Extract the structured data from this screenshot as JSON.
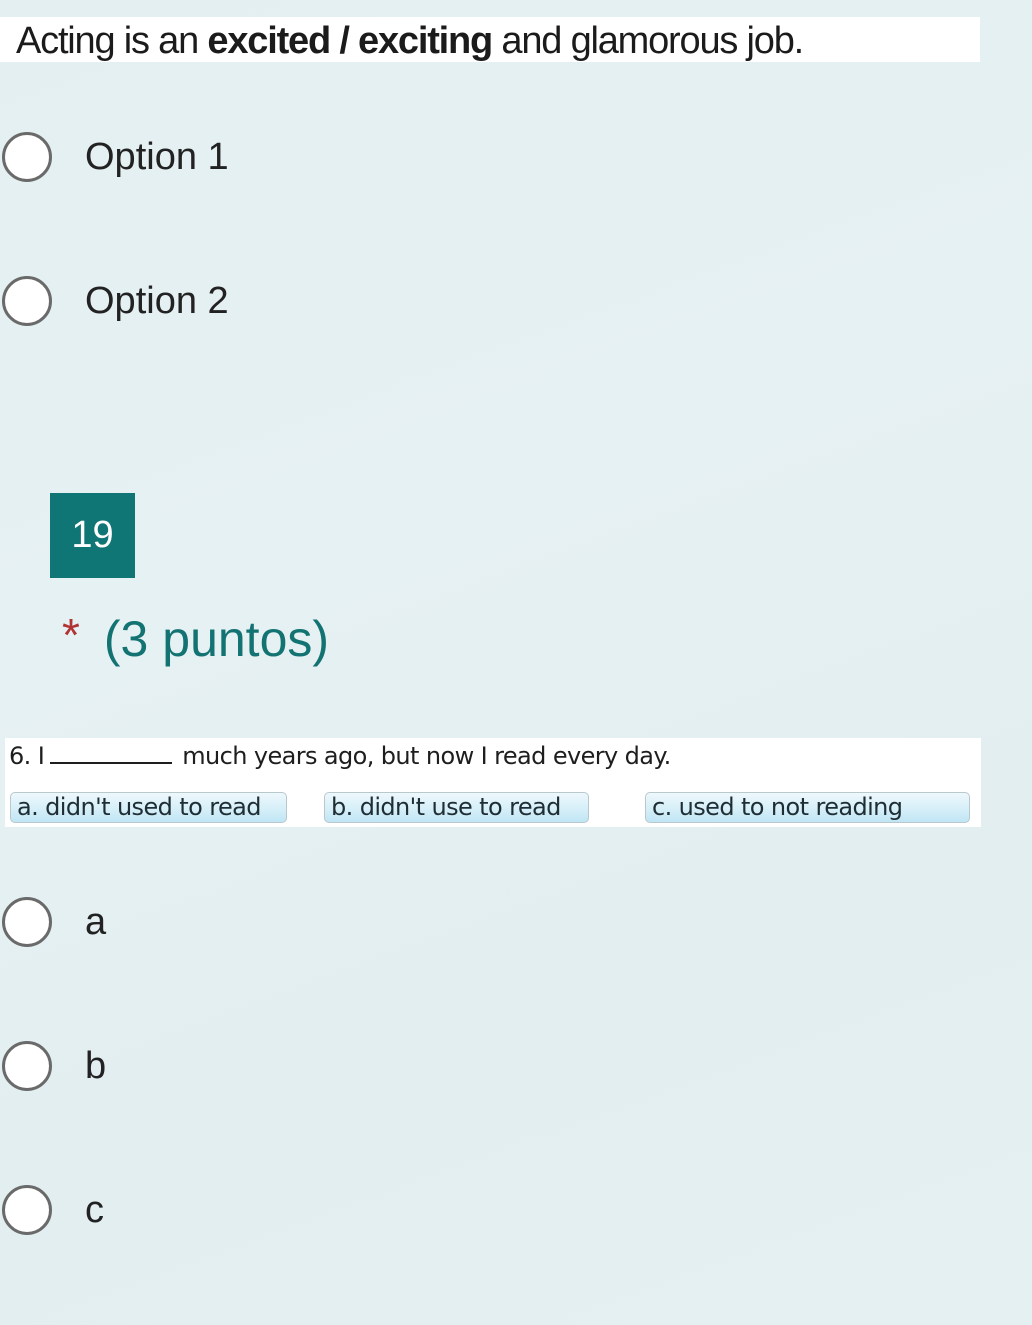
{
  "previous_question": {
    "image_text": {
      "before": "Acting is an ",
      "bold": "excited / exciting",
      "after": " and glamorous job."
    },
    "options": [
      {
        "label": "Option 1",
        "selected": false
      },
      {
        "label": "Option 2",
        "selected": false
      }
    ]
  },
  "question": {
    "number": "19",
    "required_marker": "*",
    "points_label": "(3 puntos)",
    "image": {
      "sentence_prefix": "6.  I",
      "sentence_suffix": "much years ago, but now I read every day.",
      "choices": [
        "a. didn't used to read",
        "b. didn't use to read",
        "c.  used to not reading"
      ]
    },
    "options": [
      {
        "label": "a",
        "selected": false
      },
      {
        "label": "b",
        "selected": false
      },
      {
        "label": "c",
        "selected": false
      }
    ]
  },
  "colors": {
    "accent": "#107575",
    "points_text": "#137272",
    "required": "#b13333",
    "background": "#e4eff1"
  }
}
